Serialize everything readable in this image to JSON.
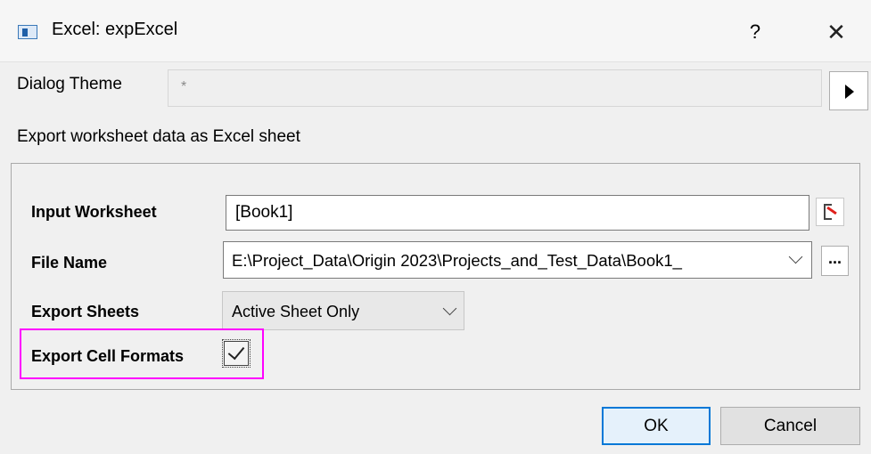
{
  "window": {
    "title": "Excel: expExcel",
    "help_label": "?",
    "close_label": "✕"
  },
  "dialog_theme": {
    "label": "Dialog Theme",
    "value": "*"
  },
  "description": "Export worksheet data as Excel sheet",
  "form": {
    "input_worksheet": {
      "label": "Input Worksheet",
      "value": "[Book1]"
    },
    "file_name": {
      "label": "File Name",
      "value": "E:\\Project_Data\\Origin 2023\\Projects_and_Test_Data\\Book1_",
      "browse_label": "..."
    },
    "export_sheets": {
      "label": "Export Sheets",
      "value": "Active Sheet Only"
    },
    "export_cell_formats": {
      "label": "Export Cell Formats",
      "checked": true
    }
  },
  "buttons": {
    "ok": "OK",
    "cancel": "Cancel"
  },
  "colors": {
    "highlight": "#ff00ff",
    "ok_border": "#0078d7"
  }
}
